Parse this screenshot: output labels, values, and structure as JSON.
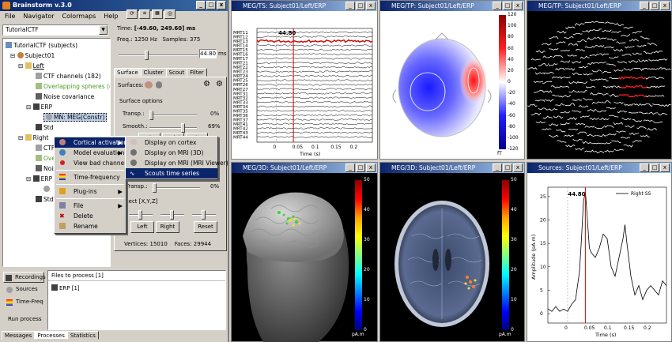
{
  "app": {
    "title": "Brainstorm v.3.0",
    "menu": [
      "File",
      "Navigator",
      "Colormaps",
      "Help"
    ]
  },
  "protocol": {
    "selected": "TutorialCTF"
  },
  "tree": {
    "root": "TutorialCTF (subjects)",
    "subject": "Subject01",
    "left": "Left",
    "ctf": "CTF channels (182)",
    "spheres": "Overlapping spheres (cortex)",
    "noise": "Noise covariance",
    "erp": "ERP",
    "mn": "MN: MEG(Constr)",
    "std": "Std",
    "right": "Right",
    "ctf2": "CTF",
    "over2": "Over",
    "noise2": "Nois",
    "erp2": "ERP",
    "std2": "Std"
  },
  "context_menu": {
    "items": [
      "Cortical activations",
      "Model evaluation",
      "View bad channels",
      "Time-frequency",
      "Plug-ins",
      "File",
      "Delete",
      "Rename"
    ]
  },
  "submenu": {
    "items": [
      "Display on cortex",
      "Display on MRI (3D)",
      "Display on MRI (MRI Viewer)",
      "Scouts time series"
    ]
  },
  "time": {
    "label": "Time:",
    "range": "[-49.60, 249.60] ms",
    "freq_label": "Freq.:",
    "freq": "1250 Hz",
    "samples_label": "Samples:",
    "samples": "375",
    "current": "44.80",
    "unit": "ms"
  },
  "tabs": [
    "Surface",
    "Cluster",
    "Scout",
    "Filter"
  ],
  "surface": {
    "label": "Surfaces:",
    "options_title": "Surface options",
    "transp_label": "Transp.:",
    "transp_val": "0%",
    "smooth_label": "Smooth.:",
    "smooth_val": "69%",
    "color_btn": "Color",
    "sulci_btn": "Sulci",
    "edge_btn": "Edge",
    "transp2_label": "Transp.:",
    "transp2_val": "0%",
    "resect_label": "sect [X,Y,Z]",
    "left_btn": "Left",
    "right_btn": "Right",
    "reset_btn": "Reset",
    "vertices_label": "Vertices:",
    "vertices": "15010",
    "faces_label": "Faces:",
    "faces": "29944"
  },
  "bottom": {
    "side": [
      "Recordings",
      "Sources",
      "Time-Freq",
      "Run process"
    ],
    "files_title": "Files to process",
    "files_count": "[1]",
    "file": "ERP [1]",
    "tabs": [
      "Messages",
      "Processes",
      "Statistics"
    ]
  },
  "fig_ts": {
    "title": "MEG/TS: Subject01/Left/ERP",
    "channels": [
      "MRT11",
      "MRT12",
      "MRT13",
      "MRT14",
      "MRT15",
      "MRT16",
      "MRT17",
      "MRT21",
      "MRT22",
      "MRT23",
      "MRT24",
      "MRT25",
      "MRT26",
      "MRT27",
      "MRT31",
      "MRT32",
      "MRT33",
      "MRT34",
      "MRT35",
      "MRT36",
      "MRT37",
      "MRT41",
      "MRT42",
      "MRT43",
      "MRT44"
    ],
    "cursor": "44.80",
    "xticks": [
      "0",
      "0.05",
      "0.1",
      "0.15",
      "0.2"
    ],
    "xlabel": "Time (s)"
  },
  "fig_tp": {
    "title": "MEG/TP: Subject01/Left/ERP",
    "ticks": [
      "120",
      "100",
      "80",
      "60",
      "40",
      "20",
      "0",
      "-20",
      "-40",
      "-60",
      "-80",
      "-100",
      "-120"
    ],
    "unit": "fT"
  },
  "fig_tp2": {
    "title": "MEG/TP: Subject01/Left/ERP"
  },
  "fig_3d": {
    "title": "MEG/3D: Subject01/Left/ERP",
    "ticks": [
      "50",
      "40",
      "30",
      "20",
      "10",
      "0"
    ],
    "unit": "pA.m"
  },
  "fig_mri": {
    "title": "MEG/3D: Subject01/Left/ERP",
    "ticks": [
      "50",
      "40",
      "30",
      "20",
      "10",
      "0"
    ],
    "unit": "pA.m"
  },
  "fig_src": {
    "title": "Sources: Subject01/Left/ERP",
    "legend": "Right SS",
    "cursor": "44.80",
    "ylabel": "Amplitude (pA.m)",
    "xlabel": "Time (s)",
    "yticks": [
      "25",
      "20",
      "15",
      "10",
      "5",
      "0"
    ],
    "xticks": [
      "0",
      "0.05",
      "0.1",
      "0.15",
      "0.2"
    ]
  },
  "chart_data": {
    "type": "line",
    "title": "",
    "xlabel": "Time (s)",
    "ylabel": "Amplitude (pA.m)",
    "ylim": [
      -2,
      27
    ],
    "xlim": [
      -0.05,
      0.25
    ],
    "series": [
      {
        "name": "Right SS",
        "x": [
          -0.05,
          -0.04,
          -0.03,
          -0.02,
          -0.01,
          0,
          0.01,
          0.02,
          0.03,
          0.035,
          0.04,
          0.045,
          0.05,
          0.055,
          0.06,
          0.07,
          0.08,
          0.09,
          0.1,
          0.11,
          0.12,
          0.13,
          0.14,
          0.145,
          0.15,
          0.16,
          0.17,
          0.18,
          0.19,
          0.2,
          0.21,
          0.22,
          0.23,
          0.24,
          0.25
        ],
        "values": [
          1,
          0.5,
          1.5,
          0.5,
          1,
          0.5,
          2,
          3,
          9,
          16,
          24,
          26,
          20,
          14,
          13,
          12,
          14,
          17,
          16,
          10,
          8,
          12,
          16,
          19,
          15,
          8,
          4,
          6,
          3,
          5,
          6,
          5,
          4,
          7,
          6
        ]
      }
    ]
  }
}
